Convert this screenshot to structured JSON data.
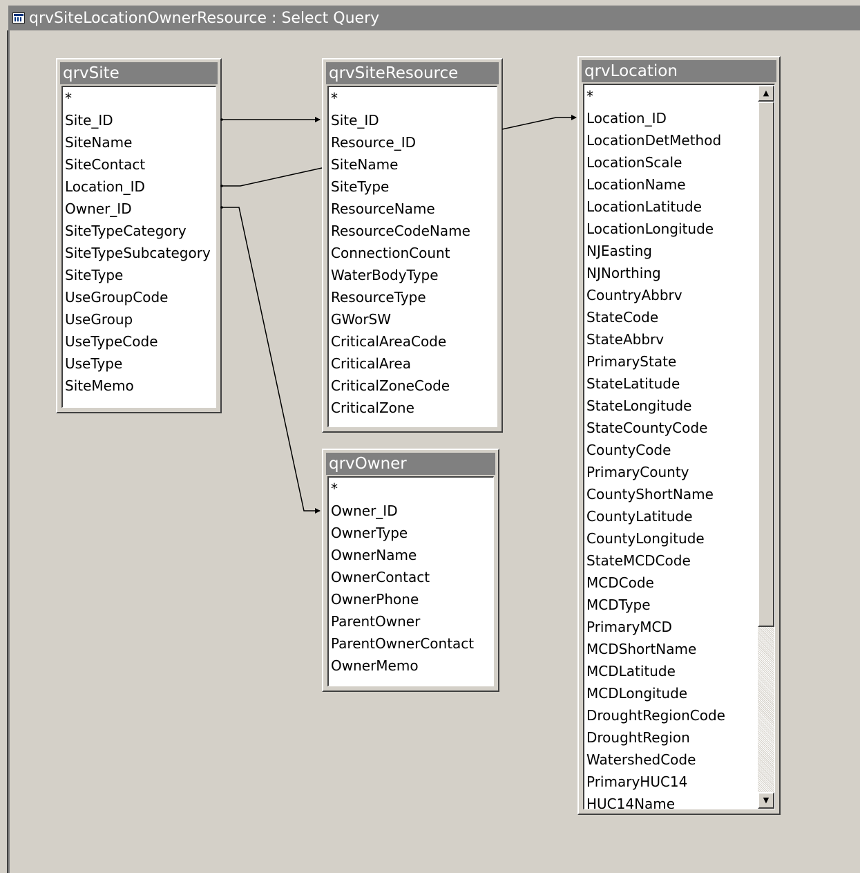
{
  "window": {
    "title": "qrvSiteLocationOwnerResource : Select Query",
    "icon": "query-grid-icon"
  },
  "tables": {
    "site": {
      "title": "qrvSite",
      "fields": [
        "*",
        "Site_ID",
        "SiteName",
        "SiteContact",
        "Location_ID",
        "Owner_ID",
        "SiteTypeCategory",
        "SiteTypeSubcategory",
        "SiteType",
        "UseGroupCode",
        "UseGroup",
        "UseTypeCode",
        "UseType",
        "SiteMemo"
      ]
    },
    "siteResource": {
      "title": "qrvSiteResource",
      "fields": [
        "*",
        "Site_ID",
        "Resource_ID",
        "SiteName",
        "SiteType",
        "ResourceName",
        "ResourceCodeName",
        "ConnectionCount",
        "WaterBodyType",
        "ResourceType",
        "GWorSW",
        "CriticalAreaCode",
        "CriticalArea",
        "CriticalZoneCode",
        "CriticalZone"
      ]
    },
    "owner": {
      "title": "qrvOwner",
      "fields": [
        "*",
        "Owner_ID",
        "OwnerType",
        "OwnerName",
        "OwnerContact",
        "OwnerPhone",
        "ParentOwner",
        "ParentOwnerContact",
        "OwnerMemo"
      ]
    },
    "location": {
      "title": "qrvLocation",
      "fields": [
        "*",
        "Location_ID",
        "LocationDetMethod",
        "LocationScale",
        "LocationName",
        "LocationLatitude",
        "LocationLongitude",
        "NJEasting",
        "NJNorthing",
        "CountryAbbrv",
        "StateCode",
        "StateAbbrv",
        "PrimaryState",
        "StateLatitude",
        "StateLongitude",
        "StateCountyCode",
        "CountyCode",
        "PrimaryCounty",
        "CountyShortName",
        "CountyLatitude",
        "CountyLongitude",
        "StateMCDCode",
        "MCDCode",
        "MCDType",
        "PrimaryMCD",
        "MCDShortName",
        "MCDLatitude",
        "MCDLongitude",
        "DroughtRegionCode",
        "DroughtRegion",
        "WatershedCode",
        "PrimaryHUC14",
        "HUC14Name"
      ],
      "scrollbar": {
        "up_icon": "scroll-up-arrow-icon",
        "down_icon": "scroll-down-arrow-icon",
        "position_fraction": 0.0
      }
    }
  },
  "joins": [
    {
      "from_table": "qrvSite",
      "from_field": "Site_ID",
      "to_table": "qrvSiteResource",
      "to_field": "Site_ID",
      "arrow": true
    },
    {
      "from_table": "qrvSite",
      "from_field": "Location_ID",
      "to_table": "qrvSiteResource",
      "to_field": "SiteName",
      "arrow": false
    },
    {
      "from_table": "qrvSite",
      "from_field": "Owner_ID",
      "to_table": "qrvOwner",
      "to_field": "Owner_ID",
      "arrow": true
    },
    {
      "from_table": "qrvSiteResource",
      "from_field": "Site_ID",
      "to_table": "qrvLocation",
      "to_field": "Location_ID",
      "arrow": true
    }
  ],
  "colors": {
    "workspace": "#d4d0c8",
    "title_bar": "#808080",
    "title_text": "#ffffff",
    "list_background": "#ffffff",
    "join_line": "#000000"
  }
}
